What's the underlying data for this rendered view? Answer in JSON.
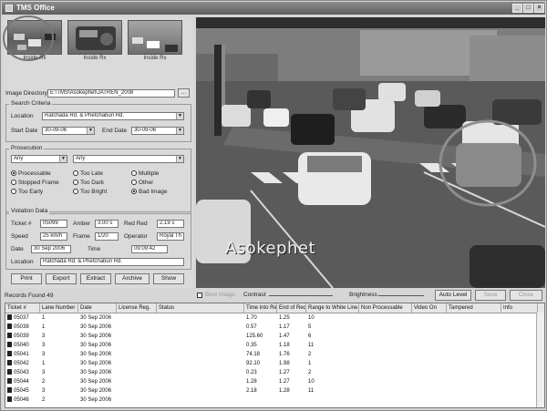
{
  "window": {
    "title": "TMS Office"
  },
  "titlebar_buttons": [
    "_",
    "□",
    "×"
  ],
  "thumbnails": [
    {
      "label": "Inside Rx"
    },
    {
      "label": "Inside Rx"
    },
    {
      "label": "Inside Rx"
    }
  ],
  "image_directory": {
    "label": "Image Directory",
    "value": "E:\\TMS\\Asokephet\\JATREN_2008",
    "browse": "..."
  },
  "search_criteria": {
    "legend": "Search Criteria",
    "location_label": "Location",
    "location_value": "Ratchada Rd. & Phetchaburi Rd.",
    "start_date_label": "Start Date",
    "start_date_value": "30-09-06",
    "end_date_label": "End Date",
    "end_date_value": "30-09-06"
  },
  "prosecution": {
    "legend": "Prosecution",
    "from_value": "Any",
    "to_value": "Any",
    "options": [
      {
        "label": "Processable",
        "checked": true
      },
      {
        "label": "Too Late",
        "checked": false
      },
      {
        "label": "Multiple",
        "checked": false
      },
      {
        "label": "Stopped Frame",
        "checked": false
      },
      {
        "label": "Too Dark",
        "checked": false
      },
      {
        "label": "Other",
        "checked": false
      },
      {
        "label": "Too Early",
        "checked": false
      },
      {
        "label": "Too Bright",
        "checked": false
      },
      {
        "label": "Bad Image",
        "checked": true
      }
    ]
  },
  "violation_data": {
    "legend": "Violation Data",
    "ticket_label": "Ticket #",
    "ticket_value": "05099",
    "amber_label": "Amber",
    "amber_value": "3.00 s",
    "red_label": "Red Red",
    "red_value": "2.19 s",
    "speed_label": "Speed",
    "speed_value": "25 km/h",
    "frame_label": "Frame",
    "frame_value": "1/20",
    "operator_label": "Operator",
    "operator_value": "Royal Th",
    "date_label": "Date",
    "date_value": "30 Sep 2006",
    "time_label": "Time",
    "time_value": "09:09:42",
    "location_label": "Location",
    "location_value": "Ratchada Rd. & Phetchaburi Rd."
  },
  "actions": [
    "Print",
    "Export",
    "Extract",
    "Archive",
    "Show"
  ],
  "camera": {
    "location_stamp": "Asokephet"
  },
  "image_controls": {
    "best_image_label": "Best Image",
    "contrast_label": "Contrast",
    "brightness_label": "Brightness",
    "auto_level_label": "Auto Level",
    "save_label": "Save",
    "close_label": "Close"
  },
  "records": {
    "label": "Records Found",
    "count": "49"
  },
  "table": {
    "columns": [
      "Ticket #",
      "Lane Number",
      "Date",
      "License Reg.",
      "Status",
      "Time into Red",
      "End of Red",
      "Range to White Line",
      "Non Processable",
      "Video On",
      "Tampered",
      "Info"
    ],
    "rows": [
      [
        "05037",
        "1",
        "30 Sep 2006",
        "",
        "",
        "1.70",
        "1.25",
        "10",
        "",
        "",
        "",
        ""
      ],
      [
        "05038",
        "1",
        "30 Sep 2006",
        "",
        "",
        "0.57",
        "1.17",
        "5",
        "",
        "",
        "",
        ""
      ],
      [
        "05039",
        "3",
        "30 Sep 2006",
        "",
        "",
        "125.60",
        "1.47",
        "6",
        "",
        "",
        "",
        ""
      ],
      [
        "05040",
        "3",
        "30 Sep 2006",
        "",
        "",
        "0.35",
        "1.18",
        "11",
        "",
        "",
        "",
        ""
      ],
      [
        "05041",
        "3",
        "30 Sep 2006",
        "",
        "",
        "74.18",
        "1.76",
        "2",
        "",
        "",
        "",
        ""
      ],
      [
        "05042",
        "1",
        "30 Sep 2006",
        "",
        "",
        "92.10",
        "1.98",
        "1",
        "",
        "",
        "",
        ""
      ],
      [
        "05043",
        "3",
        "30 Sep 2006",
        "",
        "",
        "0.23",
        "1.27",
        "2",
        "",
        "",
        "",
        ""
      ],
      [
        "05044",
        "2",
        "30 Sep 2006",
        "",
        "",
        "1.28",
        "1.27",
        "10",
        "",
        "",
        "",
        ""
      ],
      [
        "05045",
        "3",
        "30 Sep 2006",
        "",
        "",
        "2.18",
        "1.28",
        "11",
        "",
        "",
        "",
        ""
      ],
      [
        "05046",
        "2",
        "30 Sep 2006",
        "",
        "",
        "",
        "",
        "",
        "",
        "",
        "",
        ""
      ]
    ]
  }
}
